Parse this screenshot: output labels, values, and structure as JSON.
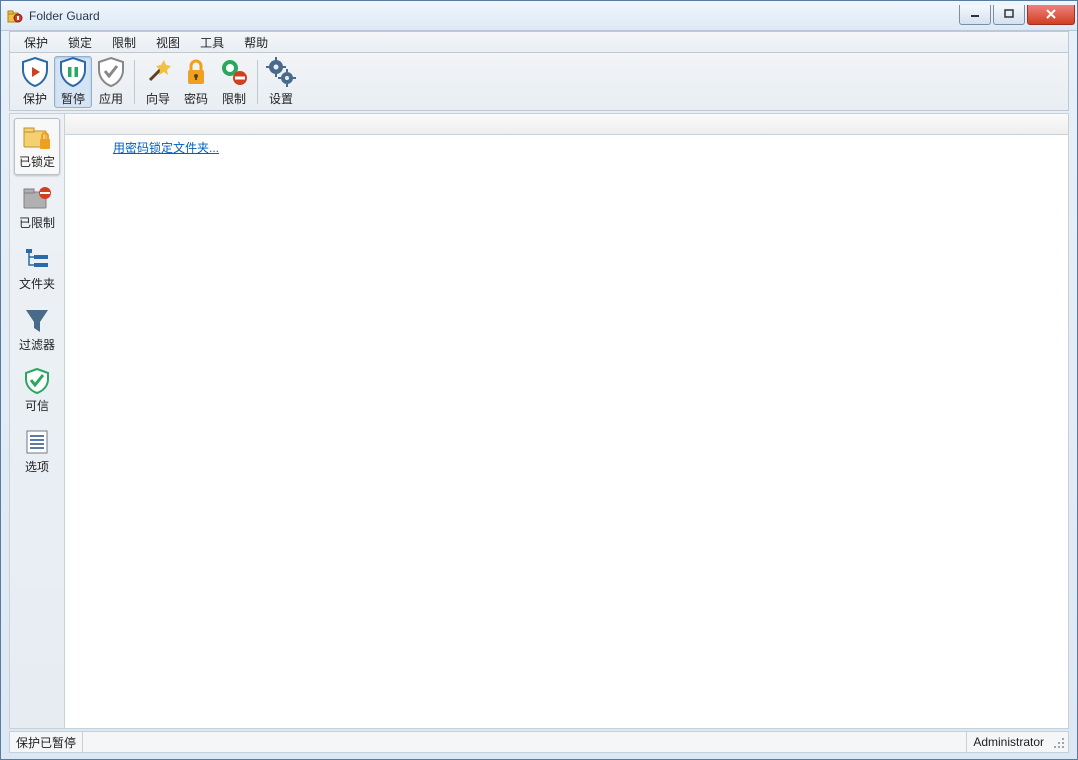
{
  "window": {
    "title": "Folder Guard"
  },
  "menubar": {
    "items": [
      {
        "label": "保护"
      },
      {
        "label": "锁定"
      },
      {
        "label": "限制"
      },
      {
        "label": "视图"
      },
      {
        "label": "工具"
      },
      {
        "label": "帮助"
      }
    ]
  },
  "toolbar": {
    "protect": "保护",
    "pause": "暂停",
    "apply": "应用",
    "wizard": "向导",
    "password": "密码",
    "restrict": "限制",
    "settings": "设置"
  },
  "sidepanel": {
    "locked": "已锁定",
    "restricted": "已限制",
    "folders": "文件夹",
    "filters": "过滤器",
    "trusted": "可信",
    "options": "选项"
  },
  "main": {
    "link_lock_with_password": "用密码锁定文件夹..."
  },
  "statusbar": {
    "left": "保护已暂停",
    "right": "Administrator"
  },
  "colors": {
    "link": "#0060c0",
    "accent_blue": "#2a6aa8",
    "accent_green": "#2aa860",
    "accent_orange": "#f0a020"
  }
}
